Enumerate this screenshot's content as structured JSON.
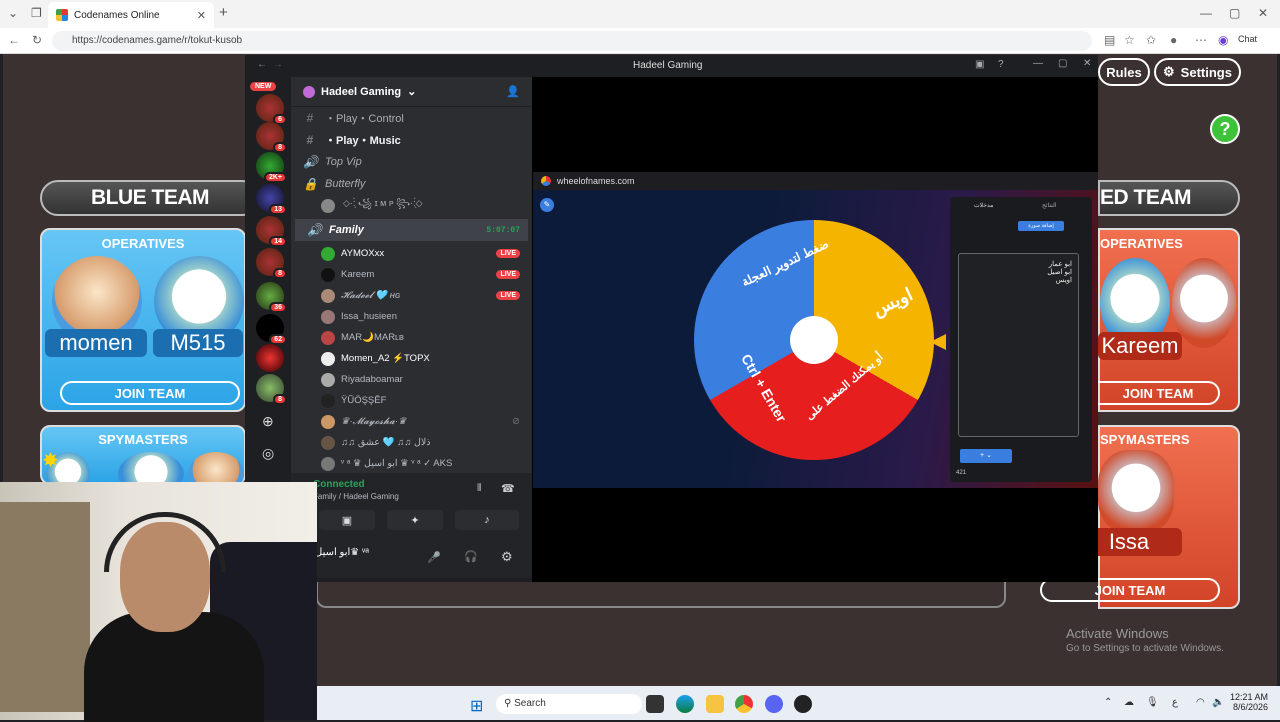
{
  "browser": {
    "tab_title": "Codenames Online",
    "url": "https://codenames.game/r/tokut-kusob",
    "chat_label": "Chat"
  },
  "game": {
    "rules_label": "Rules",
    "settings_label": "Settings",
    "help_label": "?",
    "blue": {
      "header": "BLUE TEAM",
      "operatives_title": "OPERATIVES",
      "operatives": [
        "momen",
        "M515"
      ],
      "join": "JOIN TEAM",
      "spymasters_title": "SPYMASTERS"
    },
    "red": {
      "header": "ED TEAM",
      "operatives_title": "OPERATIVES",
      "operatives": [
        "Kareem"
      ],
      "join": "JOIN TEAM",
      "spymasters_title": "SPYMASTERS",
      "spymasters": [
        "Issa"
      ],
      "join2": "JOIN TEAM"
    },
    "watermark_title": "Activate Windows",
    "watermark_sub": "Go to Settings to activate Windows."
  },
  "discord": {
    "window_title": "Hadeel Gaming",
    "server_name": "Hadeel Gaming",
    "new_badge": "NEW",
    "server_badges": [
      "6",
      "8",
      "2K+",
      "13",
      "14",
      "8",
      "36",
      "62",
      "8"
    ],
    "channels": [
      {
        "sym": "#",
        "name": "・Play・Control"
      },
      {
        "sym": "#",
        "name": "・Play・Music"
      },
      {
        "sym": "🔊",
        "name": "Top Vip"
      },
      {
        "sym": "🔒",
        "name": "Butterfly"
      },
      {
        "sym": "",
        "name": "◇·:̗̀ ꧁ ɪ ᴍ ᴘ ꧂·:̖́◇"
      },
      {
        "sym": "🔊",
        "name": "Family",
        "time": "5:07:07"
      }
    ],
    "members": [
      {
        "name": "AYMOXxx",
        "live": "LIVE"
      },
      {
        "name": "Kareem",
        "live": "LIVE"
      },
      {
        "name": "𝓗𝓪𝓭𝓮𝓮𝓵 🩵 ʜɢ",
        "live": "LIVE"
      },
      {
        "name": "Issa_husieen",
        "live": ""
      },
      {
        "name": "MAR🌙MARʟʙ",
        "live": ""
      },
      {
        "name": "Momen_A2 ⚡TOPX",
        "live": ""
      },
      {
        "name": "Riyadaboamar",
        "live": ""
      },
      {
        "name": "ŸŨÖŞŞĒF",
        "live": ""
      },
      {
        "name": "♛·𝓜𝓪𝔂𝓸𝓼𝓱𝓪·♛",
        "live": ""
      },
      {
        "name": "♫♫ ذلال ♫♫ 🩵 عشق",
        "live": ""
      },
      {
        "name": "ᵛ ᵃ ♛ ابو اسيل ♛ ᵛ ᵃ ✓ AKS",
        "live": ""
      }
    ],
    "voice_status": "Connected",
    "voice_channel": "Family / Hadeel Gaming",
    "user_name": "ابو اسيل♛ ᵛᵃ"
  },
  "wheel": {
    "site": "wheelofnames.com",
    "segments": [
      "اويس",
      "ضغط لتدوير العجلة",
      "Ctrl + Enter",
      "أو يمكنك الضغط على"
    ],
    "entries_tab": "مدخلات",
    "results_tab": "النتائج",
    "entries": [
      "ابو عمار",
      "ابو اصيل",
      "اويس"
    ],
    "add_btn": "إضافة صورة",
    "count": "421"
  },
  "taskbar": {
    "search": "Search",
    "time": "12:21 AM",
    "date": "8/6/2026",
    "lang": "ع"
  },
  "colors": {
    "blue": "#2ba4e6",
    "red": "#d24427",
    "discord_bg": "#2b2d31",
    "live": "#ed4245",
    "green": "#3ec23a"
  }
}
